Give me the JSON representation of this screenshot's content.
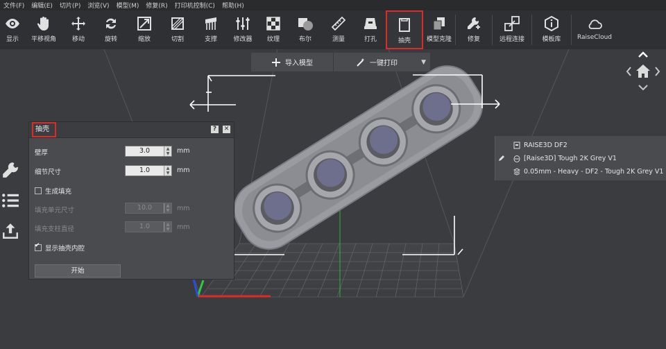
{
  "menubar": [
    "文件(F)",
    "编辑(E)",
    "切片(P)",
    "浏览(V)",
    "模型(M)",
    "修复(R)",
    "打印机控制(C)",
    "帮助(H)"
  ],
  "toolbar": {
    "tools": [
      {
        "id": "display",
        "label": "显示"
      },
      {
        "id": "pan",
        "label": "平移视角"
      },
      {
        "id": "move",
        "label": "移动"
      },
      {
        "id": "rotate",
        "label": "旋转"
      },
      {
        "id": "scale",
        "label": "缩放"
      },
      {
        "id": "cut",
        "label": "切割"
      },
      {
        "id": "support",
        "label": "支撑"
      },
      {
        "id": "modifier",
        "label": "修改器"
      },
      {
        "id": "texture",
        "label": "纹理"
      },
      {
        "id": "boolean",
        "label": "布尔"
      },
      {
        "id": "measure",
        "label": "测量"
      },
      {
        "id": "hole",
        "label": "打孔"
      },
      {
        "id": "shell",
        "label": "抽壳",
        "active": true
      },
      {
        "id": "clone",
        "label": "模型克隆"
      },
      {
        "id": "repair",
        "label": "修复"
      },
      {
        "id": "remote",
        "label": "远程连接"
      },
      {
        "id": "library",
        "label": "模板库"
      },
      {
        "id": "cloud",
        "label": "RaiseCloud"
      }
    ]
  },
  "topbar": {
    "import_label": "导入模型",
    "oneclick_label": "一键打印"
  },
  "shell_panel": {
    "title": "抽壳",
    "help": "?",
    "close": "✕",
    "wall_label": "壁厚",
    "wall_value": "3.0",
    "detail_label": "细节尺寸",
    "detail_value": "1.0",
    "unit": "mm",
    "fill_label": "生成填充",
    "fill_checked": false,
    "cell_label": "填充单元尺寸",
    "cell_value": "10.0",
    "support_label": "填充支柱直径",
    "support_value": "1.0",
    "show_cavity_label": "显示抽壳内腔",
    "show_cavity_checked": true,
    "start_label": "开始"
  },
  "printer_info": {
    "printer": "RAISE3D DF2",
    "material": "[Raise3D] Tough 2K Grey V1",
    "profile": "0.05mm - Heavy - DF2 - Tough 2K Grey V1"
  },
  "colors": {
    "accent": "#e02a2a",
    "background": "#3b3c3f",
    "panel": "#4a4b4e"
  }
}
